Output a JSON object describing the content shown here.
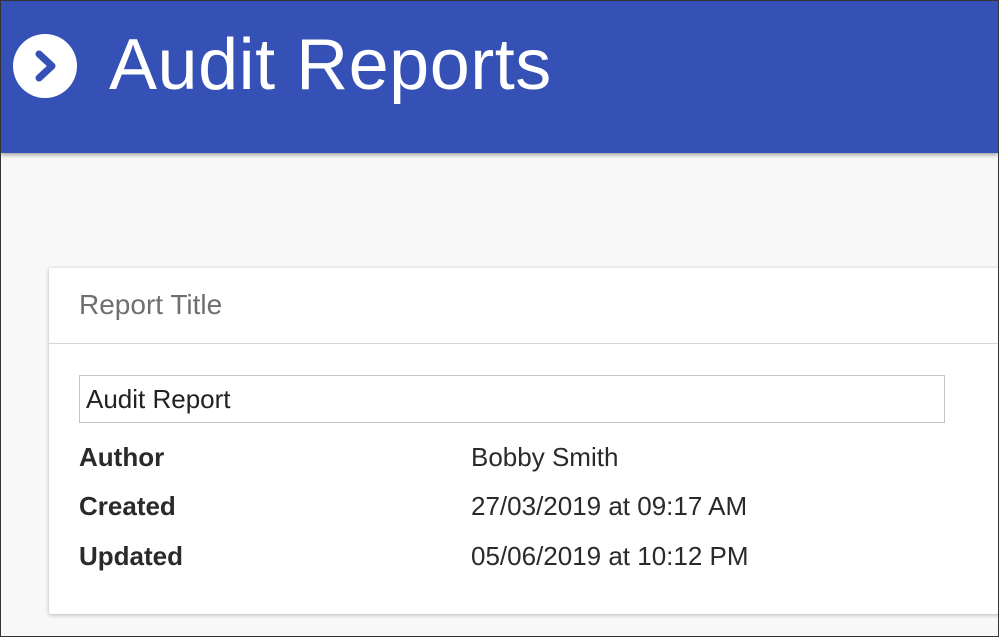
{
  "header": {
    "title": "Audit Reports",
    "back_icon": "chevron-right-circle-icon",
    "background_color": "#3651b5"
  },
  "card": {
    "header_title": "Report Title",
    "title_input": {
      "value": "Audit Report",
      "placeholder": ""
    },
    "details": [
      {
        "label": "Author",
        "value": "Bobby Smith"
      },
      {
        "label": "Created",
        "value": "27/03/2019 at 09:17 AM"
      },
      {
        "label": "Updated",
        "value": "05/06/2019 at 10:12 PM"
      }
    ]
  }
}
